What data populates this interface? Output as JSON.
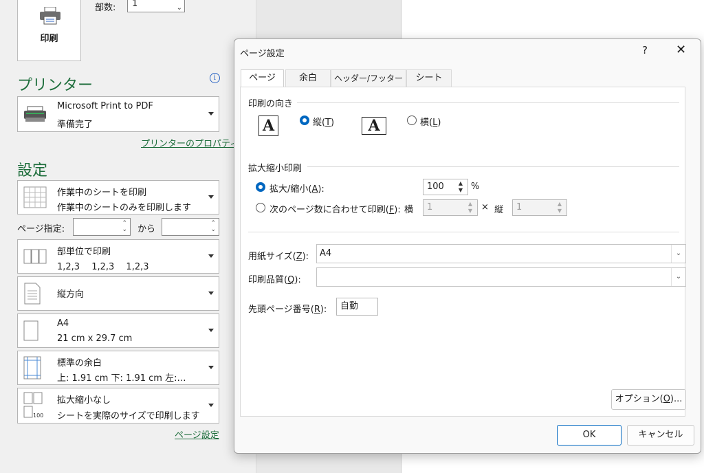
{
  "backstage": {
    "print_button": "印刷",
    "copies_label": "部数:",
    "copies_value": "1",
    "printer_heading": "プリンター",
    "printer_name": "Microsoft Print to PDF",
    "printer_status": "準備完了",
    "printer_props_link": "プリンターのプロパティ",
    "settings_heading": "設定",
    "settings": [
      {
        "line1": "作業中のシートを印刷",
        "line2": "作業中のシートのみを印刷します"
      },
      {
        "line1": "部単位で印刷",
        "line2": "1,2,3　 1,2,3　 1,2,3"
      },
      {
        "line1": "縦方向",
        "line2": ""
      },
      {
        "line1": "A4",
        "line2": "21 cm x 29.7 cm"
      },
      {
        "line1": "標準の余白",
        "line2": "上: 1.91 cm 下: 1.91 cm 左:…"
      },
      {
        "line1": "拡大縮小なし",
        "line2": "シートを実際のサイズで印刷します"
      }
    ],
    "pages_label": "ページ指定:",
    "pages_to": "から",
    "page_setup_link": "ページ設定",
    "scale_icon_text": "100"
  },
  "dialog": {
    "title": "ページ設定",
    "help": "?",
    "close": "✕",
    "tabs": [
      "ページ",
      "余白",
      "ヘッダー/フッター",
      "シート"
    ],
    "orientation": {
      "heading": "印刷の向き",
      "portrait_pre": "縦(",
      "portrait_key": "T",
      "post": ")",
      "landscape_pre": "横(",
      "landscape_key": "L",
      "icon_letter": "A"
    },
    "scaling": {
      "heading": "拡大縮小印刷",
      "adjust_pre": "拡大/縮小(",
      "adjust_key": "A",
      "adjust_post": "):",
      "adjust_value": "100",
      "percent": "%",
      "fit_pre": "次のページ数に合わせて印刷(",
      "fit_key": "F",
      "fit_post": "):",
      "wide_label": "横",
      "wide_value": "1",
      "times": "×",
      "tall_label": "縦",
      "tall_value": "1"
    },
    "paper_size": {
      "pre": "用紙サイズ(",
      "key": "Z",
      "post": "):",
      "value": "A4"
    },
    "print_quality": {
      "pre": "印刷品質(",
      "key": "Q",
      "post": "):",
      "value": ""
    },
    "first_page": {
      "pre": "先頭ページ番号(",
      "key": "R",
      "post": "):",
      "value": "自動"
    },
    "options_button": {
      "pre": "オプション(",
      "key": "O",
      "post": ")..."
    },
    "ok": "OK",
    "cancel": "キャンセル"
  },
  "colors": {
    "accent": "#0067c0",
    "excel_green": "#1e6e3c"
  }
}
